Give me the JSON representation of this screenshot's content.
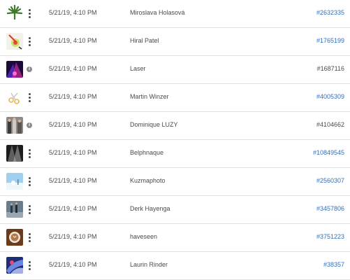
{
  "rows": [
    {
      "thumb": "cannabis-leaf-thumbnail",
      "action": "more-options",
      "date": "5/21/19, 4:10 PM",
      "author": "Miroslava Holasová",
      "id": "#2632335",
      "linked": true
    },
    {
      "thumb": "pencil-target-thumbnail",
      "action": "more-options",
      "date": "5/21/19, 4:10 PM",
      "author": "Hiral Patel",
      "id": "#1765199",
      "linked": true
    },
    {
      "thumb": "laser-lights-thumbnail",
      "action": "info",
      "date": "5/21/19, 4:10 PM",
      "author": "Laser",
      "id": "#1687116",
      "linked": false
    },
    {
      "thumb": "scissors-thumbnail",
      "action": "more-options",
      "date": "5/21/19, 4:10 PM",
      "author": "Martin Winzer",
      "id": "#4005309",
      "linked": true
    },
    {
      "thumb": "crowd-thumbnail",
      "action": "info",
      "date": "5/21/19, 4:10 PM",
      "author": "Dominique LUZY",
      "id": "#4104662",
      "linked": false
    },
    {
      "thumb": "dark-stage-thumbnail",
      "action": "more-options",
      "date": "5/21/19, 4:10 PM",
      "author": "Belphnaque",
      "id": "#10849545",
      "linked": true
    },
    {
      "thumb": "winter-scene-thumbnail",
      "action": "more-options",
      "date": "5/21/19, 4:10 PM",
      "author": "Kuzmaphoto",
      "id": "#2560307",
      "linked": true
    },
    {
      "thumb": "street-people-thumbnail",
      "action": "more-options",
      "date": "5/21/19, 4:10 PM",
      "author": "Derk Hayenga",
      "id": "#3457806",
      "linked": true
    },
    {
      "thumb": "coffee-cup-thumbnail",
      "action": "more-options",
      "date": "5/21/19, 4:10 PM",
      "author": "haveseen",
      "id": "#3751223",
      "linked": true
    },
    {
      "thumb": "blue-abstract-thumbnail",
      "action": "more-options",
      "date": "5/21/19, 4:10 PM",
      "author": "Laurin Rinder",
      "id": "#38357",
      "linked": true
    }
  ],
  "colors": {
    "link": "#2c6fc2",
    "text": "#4b4b4b",
    "divider": "#e1e1e1"
  }
}
